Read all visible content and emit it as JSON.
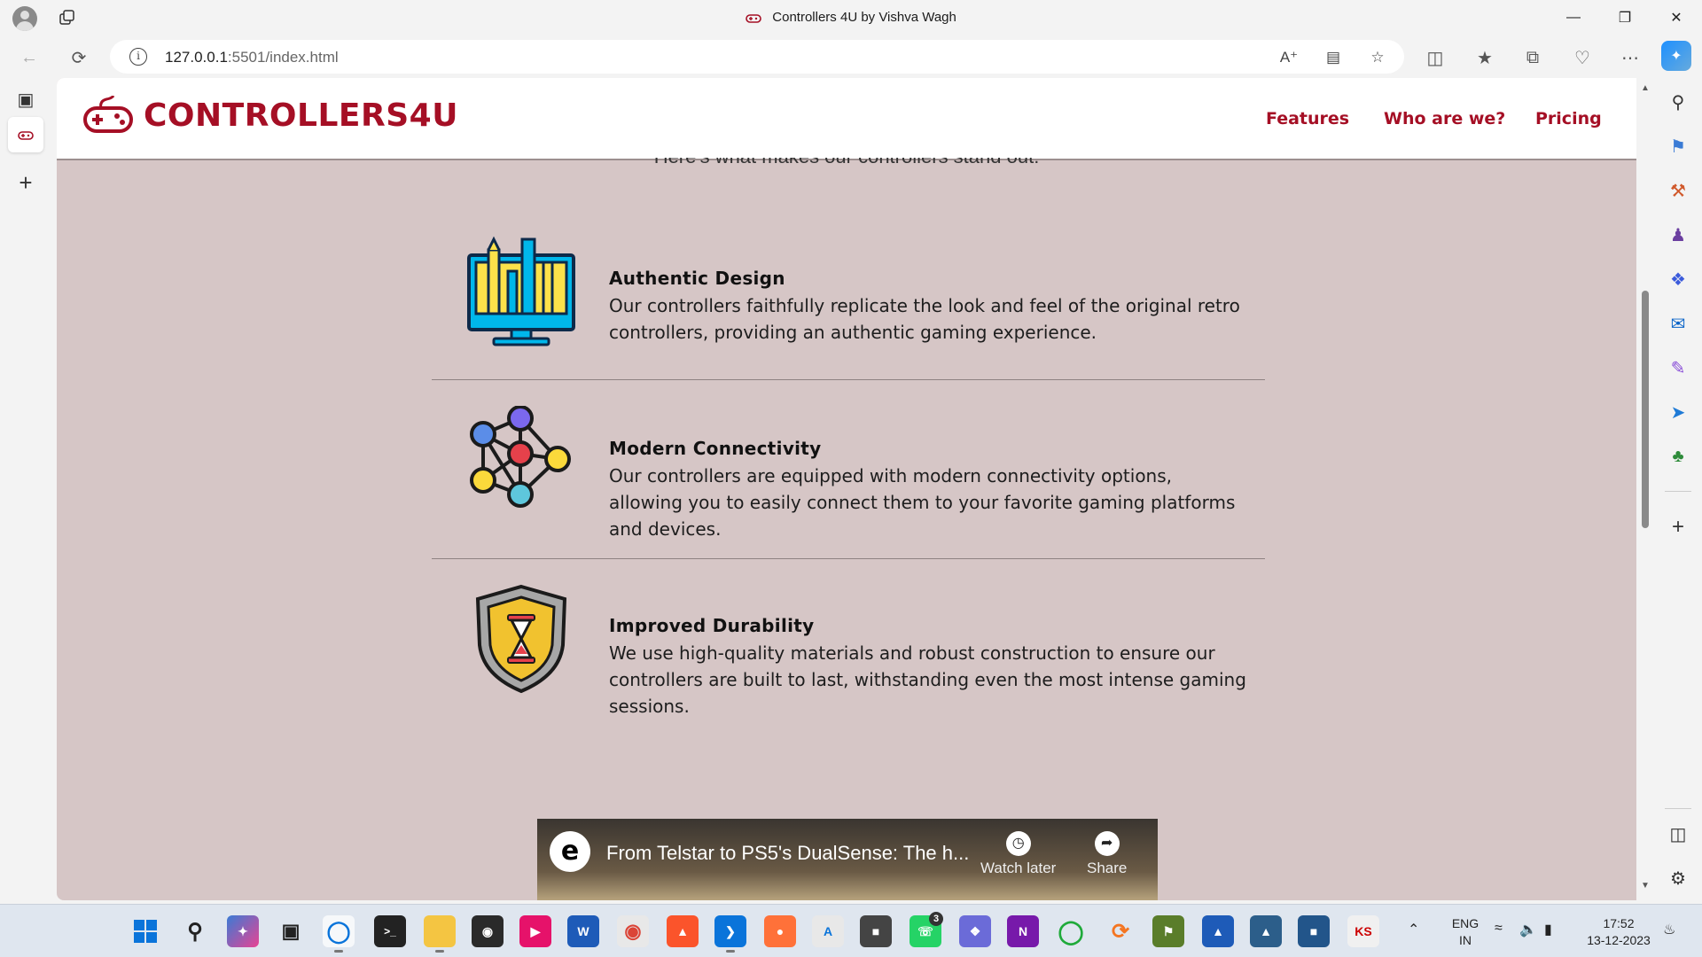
{
  "browser": {
    "tab_title": "Controllers 4U by Vishva Wagh",
    "url_host": "127.0.0.1",
    "url_path": ":5501/index.html"
  },
  "site": {
    "logo_text": "CONTROLLERS4U",
    "nav": [
      "Features",
      "Who are we?",
      "Pricing"
    ],
    "intro_fragment": "Here's what makes our controllers stand out:",
    "features": [
      {
        "title": "Authentic Design",
        "description": "Our controllers faithfully replicate the look and feel of the original retro controllers, providing an authentic gaming experience.",
        "icon": "monitor-design-icon"
      },
      {
        "title": "Modern Connectivity",
        "description": "Our controllers are equipped with modern connectivity options, allowing you to easily connect them to your favorite gaming platforms and devices.",
        "icon": "network-nodes-icon"
      },
      {
        "title": "Improved Durability",
        "description": "We use high-quality materials and robust construction to ensure our controllers are built to last, withstanding even the most intense gaming sessions.",
        "icon": "shield-hourglass-icon"
      }
    ],
    "video": {
      "title": "From Telstar to PS5's DualSense: The h...",
      "watch_later": "Watch later",
      "share": "Share"
    }
  },
  "taskbar": {
    "language": "ENG",
    "region": "IN",
    "time": "17:52",
    "date": "13-12-2023",
    "whatsapp_badge": "3"
  },
  "colors": {
    "brand": "#a50f25",
    "page_bg": "#d6c6c6"
  }
}
